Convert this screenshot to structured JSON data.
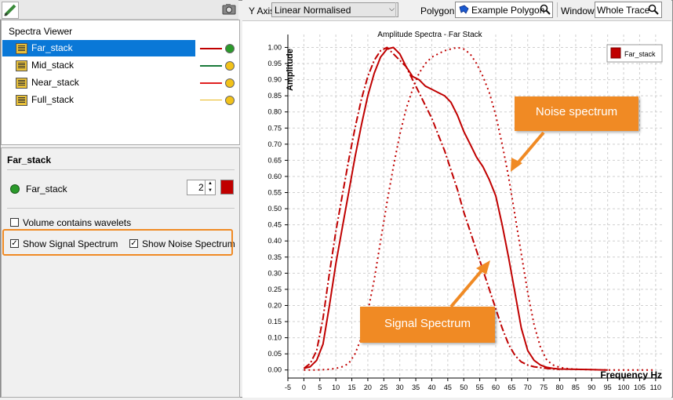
{
  "left_panel": {
    "viewer_title": "Spectra Viewer",
    "items": [
      {
        "label": "Far_stack",
        "line_color": "#c00000",
        "dot_color": "#2a9a2a",
        "selected": true
      },
      {
        "label": "Mid_stack",
        "line_color": "#1a7a3a",
        "dot_color": "#f2c21a",
        "selected": false
      },
      {
        "label": "Near_stack",
        "line_color": "#e02020",
        "dot_color": "#f2c21a",
        "selected": false
      },
      {
        "label": "Full_stack",
        "line_color": "#e8b820",
        "dot_color": "#f2c21a",
        "selected": false
      }
    ],
    "properties": {
      "title": "Far_stack",
      "volume_name": "Far_stack",
      "line_width": "2",
      "color": "#c00000",
      "volume_contains_wavelets_label": "Volume contains wavelets",
      "volume_contains_wavelets_checked": false,
      "show_signal_label": "Show Signal Spectrum",
      "show_signal_checked": true,
      "show_noise_label": "Show Noise Spectrum",
      "show_noise_checked": true,
      "check_mark": "✓"
    }
  },
  "toolbar": {
    "y_axis_label": "Y Axis",
    "y_axis_value": "Linear Normalised",
    "polygon_label": "Polygon",
    "polygon_value": "Example Polygon",
    "window_label": "Window",
    "window_value": "Whole Trace"
  },
  "chart_data": {
    "type": "line",
    "title": "Amplitude Spectra  - Far Stack",
    "xlabel": "Frequency Hz",
    "ylabel": "Amplitude",
    "xlim": [
      -5,
      112
    ],
    "ylim": [
      -0.025,
      1.04
    ],
    "xticks": [
      -5,
      0,
      5,
      10,
      15,
      20,
      25,
      30,
      35,
      40,
      45,
      50,
      55,
      60,
      65,
      70,
      75,
      80,
      85,
      90,
      95,
      100,
      105,
      110
    ],
    "yticks": [
      0.0,
      0.05,
      0.1,
      0.15,
      0.2,
      0.25,
      0.3,
      0.35,
      0.4,
      0.45,
      0.5,
      0.55,
      0.6,
      0.65,
      0.7,
      0.75,
      0.8,
      0.85,
      0.9,
      0.95,
      1.0
    ],
    "grid": true,
    "legend": {
      "label": "Far_stack",
      "color": "#c00000",
      "position": "top-right"
    },
    "series": [
      {
        "name": "Far_stack",
        "style": "solid",
        "color": "#c00000",
        "x": [
          0,
          2,
          4,
          6,
          8,
          10,
          12,
          14,
          16,
          18,
          20,
          22,
          24,
          26,
          28,
          30,
          32,
          34,
          36,
          38,
          40,
          42,
          44,
          46,
          48,
          50,
          52,
          54,
          56,
          58,
          60,
          62,
          64,
          66,
          68,
          70,
          72,
          74,
          76,
          78,
          80,
          85,
          90,
          95
        ],
        "y": [
          0.005,
          0.01,
          0.03,
          0.08,
          0.2,
          0.33,
          0.44,
          0.55,
          0.66,
          0.76,
          0.85,
          0.92,
          0.97,
          0.995,
          1.0,
          0.98,
          0.94,
          0.91,
          0.9,
          0.88,
          0.87,
          0.86,
          0.85,
          0.83,
          0.79,
          0.74,
          0.7,
          0.66,
          0.63,
          0.59,
          0.54,
          0.45,
          0.35,
          0.24,
          0.13,
          0.06,
          0.03,
          0.015,
          0.008,
          0.005,
          0.003,
          0.002,
          0.001,
          0.0
        ]
      },
      {
        "name": "",
        "style": "dash-dot",
        "color": "#c00000",
        "x": [
          0,
          2,
          4,
          6,
          8,
          10,
          12,
          14,
          16,
          18,
          20,
          22,
          24,
          26,
          28,
          30,
          32,
          34,
          36,
          38,
          40,
          42,
          44,
          46,
          48,
          50,
          52,
          54,
          56,
          58,
          60,
          62,
          64,
          66,
          68,
          70,
          72,
          74,
          76,
          78,
          80
        ],
        "y": [
          0.005,
          0.02,
          0.06,
          0.16,
          0.3,
          0.43,
          0.54,
          0.65,
          0.75,
          0.84,
          0.91,
          0.96,
          0.99,
          1.0,
          0.98,
          0.96,
          0.94,
          0.9,
          0.86,
          0.82,
          0.78,
          0.73,
          0.68,
          0.62,
          0.56,
          0.49,
          0.43,
          0.37,
          0.31,
          0.25,
          0.19,
          0.13,
          0.08,
          0.045,
          0.025,
          0.015,
          0.01,
          0.007,
          0.005,
          0.003,
          0.002
        ]
      },
      {
        "name": "",
        "style": "dotted",
        "color": "#c00000",
        "x": [
          0,
          4,
          8,
          10,
          12,
          14,
          16,
          18,
          20,
          22,
          24,
          26,
          28,
          30,
          32,
          34,
          36,
          38,
          40,
          42,
          44,
          46,
          48,
          50,
          52,
          54,
          56,
          58,
          60,
          62,
          64,
          66,
          68,
          70,
          72,
          74,
          76,
          78,
          80,
          82,
          84,
          86,
          90,
          95,
          100,
          105,
          110
        ],
        "y": [
          0.0,
          0.0,
          0.002,
          0.005,
          0.01,
          0.02,
          0.05,
          0.1,
          0.18,
          0.28,
          0.4,
          0.52,
          0.63,
          0.73,
          0.81,
          0.87,
          0.92,
          0.95,
          0.97,
          0.98,
          0.99,
          0.995,
          1.0,
          0.995,
          0.98,
          0.95,
          0.91,
          0.86,
          0.79,
          0.7,
          0.6,
          0.48,
          0.36,
          0.24,
          0.14,
          0.07,
          0.03,
          0.015,
          0.008,
          0.005,
          0.003,
          0.002,
          0.001,
          0.0,
          0.0,
          0.0,
          0.0
        ]
      }
    ]
  },
  "annotations": {
    "noise_callout": "Noise spectrum",
    "signal_callout": "Signal Spectrum",
    "callout_color": "#f08a24"
  }
}
